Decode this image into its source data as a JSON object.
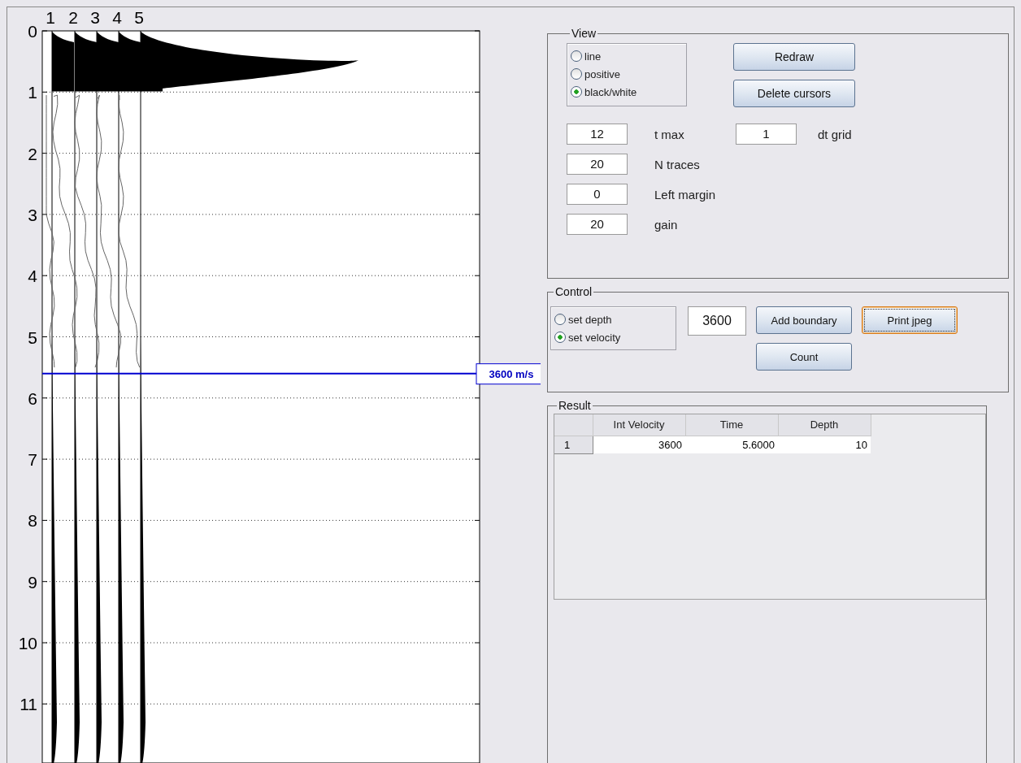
{
  "plot": {
    "trace_labels": [
      "1",
      "2",
      "3",
      "4",
      "5"
    ],
    "y_ticks": [
      "0",
      "1",
      "2",
      "3",
      "4",
      "5",
      "6",
      "7",
      "8",
      "9",
      "10",
      "11"
    ],
    "cursor": {
      "label": "3600 m/s"
    }
  },
  "view": {
    "title": "View",
    "display_modes": [
      {
        "label": "line",
        "selected": false
      },
      {
        "label": "positive",
        "selected": false
      },
      {
        "label": "black/white",
        "selected": true
      }
    ],
    "buttons": [
      {
        "label": "Redraw",
        "focused": false
      },
      {
        "label": "Delete cursors",
        "focused": false
      }
    ],
    "dt_grid": {
      "value": "1",
      "label": "dt grid"
    },
    "fields": [
      {
        "value": "12",
        "label": "t max"
      },
      {
        "value": "20",
        "label": "N traces"
      },
      {
        "value": "0",
        "label": "Left margin"
      },
      {
        "value": "20",
        "label": "gain"
      }
    ]
  },
  "control": {
    "title": "Control",
    "modes": [
      {
        "label": "set depth",
        "selected": false
      },
      {
        "label": "set velocity",
        "selected": true
      }
    ],
    "value": "3600",
    "buttons": [
      {
        "label": "Add boundary",
        "focused": false
      },
      {
        "label": "Print jpeg",
        "focused": true
      },
      {
        "label": "Count",
        "focused": false
      }
    ]
  },
  "result": {
    "title": "Result",
    "table": {
      "columns": [
        "Int Velocity",
        "Time",
        "Depth"
      ],
      "rows": [
        {
          "header": "1",
          "cells": [
            "3600",
            "5.6000",
            "10"
          ]
        }
      ]
    }
  }
}
